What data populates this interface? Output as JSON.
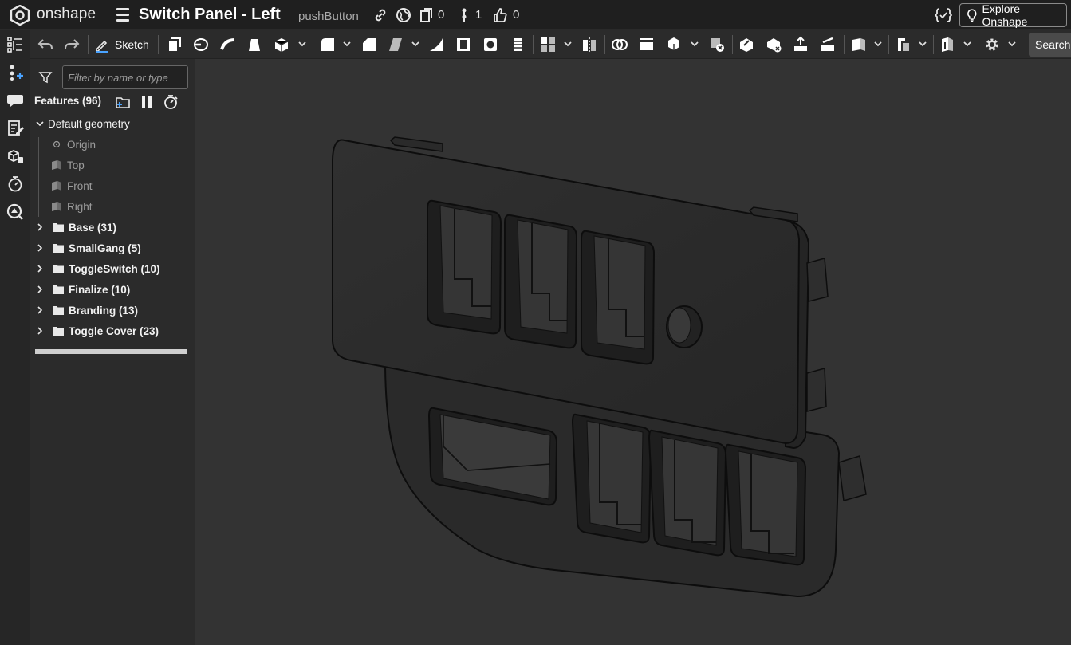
{
  "app": {
    "brand": "onshape",
    "doc_title": "Switch Panel - Left",
    "workspace": "pushButton",
    "counts": {
      "versions": "0",
      "branches": "1",
      "likes": "0"
    },
    "explore_label": "Explore Onshape"
  },
  "toolbar": {
    "sketch_label": "Sketch",
    "search_label": "Search"
  },
  "filter": {
    "placeholder": "Filter by name or type"
  },
  "features": {
    "header": "Features (96)",
    "default_geometry": {
      "label": "Default geometry",
      "items": [
        "Origin",
        "Top",
        "Front",
        "Right"
      ]
    },
    "folders": [
      "Base (31)",
      "SmallGang (5)",
      "ToggleSwitch (10)",
      "Finalize (10)",
      "Branding (13)",
      "Toggle Cover (23)"
    ]
  },
  "icons": {
    "rail": [
      "feature-list-icon",
      "variables-icon",
      "comments-icon",
      "notes-icon",
      "parts-icon",
      "rollback-timer-icon",
      "analysis-icon"
    ]
  },
  "colors": {
    "topbar": "#1f1f1f",
    "toolbar": "#2b2b2b",
    "panel": "#2b2b2b",
    "viewport": "#333333",
    "model": "#2a2a2a"
  }
}
